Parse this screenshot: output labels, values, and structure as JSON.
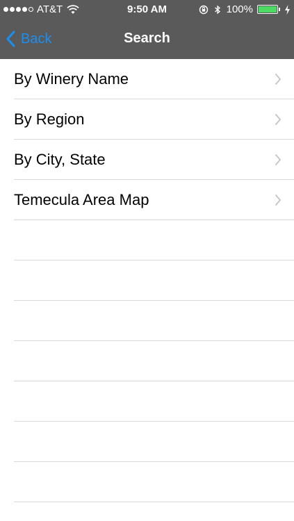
{
  "status_bar": {
    "carrier": "AT&T",
    "time": "9:50 AM",
    "battery_percent": "100%",
    "signal_bars_filled": 4,
    "signal_bars_total": 5,
    "battery_color": "#4cd964"
  },
  "nav": {
    "back_label": "Back",
    "title": "Search",
    "accent": "#1b8ff0",
    "background": "#5a5a5a"
  },
  "list": {
    "items": [
      {
        "label": "By Winery Name",
        "icon": "chevron-right-icon"
      },
      {
        "label": "By Region",
        "icon": "chevron-right-icon"
      },
      {
        "label": "By City, State",
        "icon": "chevron-right-icon"
      },
      {
        "label": "Temecula Area Map",
        "icon": "chevron-right-icon"
      }
    ],
    "empty_rows": 7
  }
}
